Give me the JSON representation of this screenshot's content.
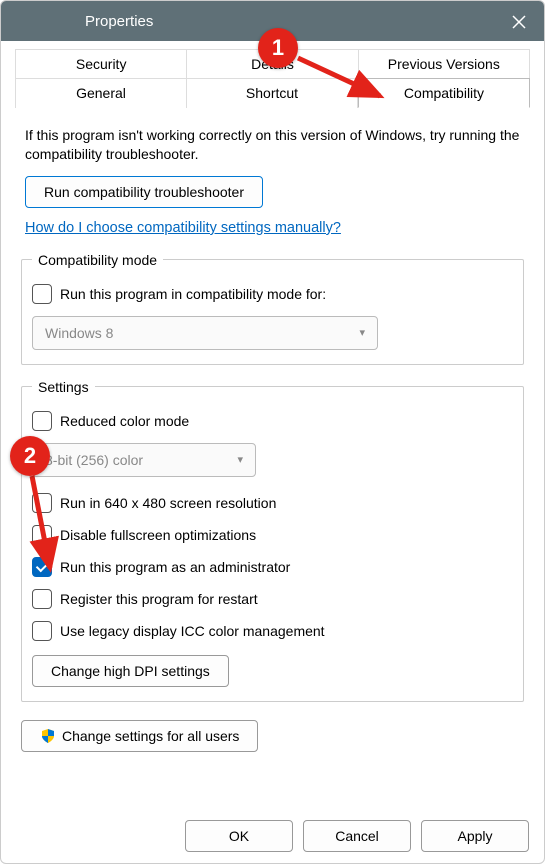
{
  "window": {
    "title": "Properties"
  },
  "tabs": {
    "row1": [
      "Security",
      "Details",
      "Previous Versions"
    ],
    "row2": [
      "General",
      "Shortcut",
      "Compatibility"
    ],
    "active": "Compatibility"
  },
  "desc": "If this program isn't working correctly on this version of Windows, try running the compatibility troubleshooter.",
  "troubleshooter_btn": "Run compatibility troubleshooter",
  "help_link": "How do I choose compatibility settings manually?",
  "compat_mode": {
    "legend": "Compatibility mode",
    "checkbox_label": "Run this program in compatibility mode for:",
    "checked": false,
    "select_value": "Windows 8"
  },
  "settings": {
    "legend": "Settings",
    "reduced_color": {
      "label": "Reduced color mode",
      "checked": false
    },
    "color_select": "8-bit (256) color",
    "run_640": {
      "label": "Run in 640 x 480 screen resolution",
      "checked": false
    },
    "disable_fs": {
      "label": "Disable fullscreen optimizations",
      "checked": false
    },
    "run_admin": {
      "label": "Run this program as an administrator",
      "checked": true
    },
    "register_restart": {
      "label": "Register this program for restart",
      "checked": false
    },
    "legacy_icc": {
      "label": "Use legacy display ICC color management",
      "checked": false
    },
    "dpi_btn": "Change high DPI settings"
  },
  "all_users_btn": "Change settings for all users",
  "buttons": {
    "ok": "OK",
    "cancel": "Cancel",
    "apply": "Apply"
  },
  "annotations": {
    "badge1": "1",
    "badge2": "2"
  }
}
